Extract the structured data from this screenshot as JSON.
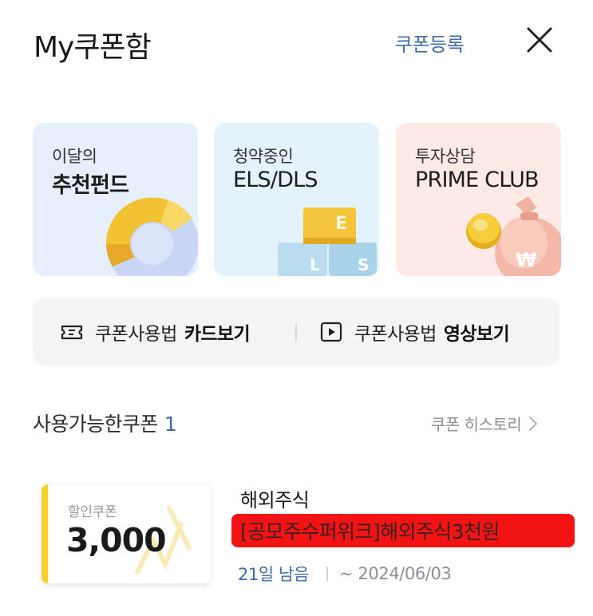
{
  "header": {
    "title": "My쿠폰함",
    "register_label": "쿠폰등록",
    "close_icon": "close-icon"
  },
  "promo_cards": [
    {
      "sub": "이달의",
      "main": "추천펀드",
      "icon": "donut-chart-icon",
      "bg": "#e7effc"
    },
    {
      "sub": "청약중인",
      "main": "ELS/DLS",
      "icon": "letter-blocks-icon",
      "bg": "#e3f2fb",
      "blocks": [
        "E",
        "L",
        "S"
      ]
    },
    {
      "sub": "투자상담",
      "main": "PRIME CLUB",
      "icon": "money-bag-icon",
      "bg": "#fde9e6",
      "bag_symbol": "₩"
    }
  ],
  "guide": {
    "card": {
      "icon": "ticket-icon",
      "label": "쿠폰사용법",
      "bold": "카드보기"
    },
    "video": {
      "icon": "play-icon",
      "label": "쿠폰사용법",
      "bold": "영상보기"
    }
  },
  "section": {
    "title": "사용가능한쿠폰",
    "count": "1",
    "history_label": "쿠폰 히스토리"
  },
  "coupon": {
    "type": "할인쿠폰",
    "amount": "3,000",
    "accent": "#f6d02a",
    "category": "해외주식",
    "name": "[공모주수퍼위크]해외주식3천원",
    "days_left": "21일 남음",
    "expiry": "~ 2024/06/03"
  },
  "colors": {
    "accent_blue": "#3f6ba8",
    "highlight_red": "#f21414"
  }
}
